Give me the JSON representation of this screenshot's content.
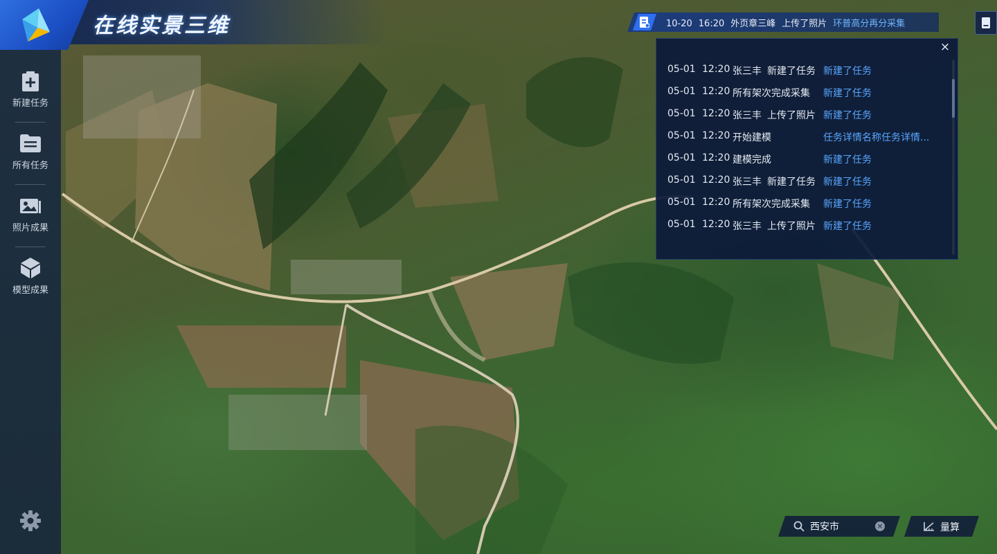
{
  "app": {
    "title": "在线实景三维"
  },
  "sidebar": {
    "items": [
      {
        "label": "新建任务",
        "icon": "new-task-icon"
      },
      {
        "label": "所有任务",
        "icon": "task-list-icon"
      },
      {
        "label": "照片成果",
        "icon": "photo-icon"
      },
      {
        "label": "模型成果",
        "icon": "cube-icon"
      }
    ],
    "settings_icon": "gear-icon"
  },
  "notice": {
    "date": "10-20",
    "time": "16:20",
    "user": "外页章三峰",
    "action": "上传了照片",
    "link": "环普高分再分采集"
  },
  "log_panel": {
    "close_label": "×",
    "rows": [
      {
        "date": "05-01",
        "time": "12:20",
        "user": "张三丰",
        "action": "新建了任务",
        "link": "新建了任务"
      },
      {
        "date": "05-01",
        "time": "12:20",
        "user": "所有架次完成采集",
        "action": "",
        "link": "新建了任务"
      },
      {
        "date": "05-01",
        "time": "12:20",
        "user": "张三丰",
        "action": "上传了照片",
        "link": "新建了任务"
      },
      {
        "date": "05-01",
        "time": "12:20",
        "user": "开始建模",
        "action": "",
        "link": "任务详情名称任务详情..."
      },
      {
        "date": "05-01",
        "time": "12:20",
        "user": "建模完成",
        "action": "",
        "link": "新建了任务"
      },
      {
        "date": "05-01",
        "time": "12:20",
        "user": "张三丰",
        "action": "新建了任务",
        "link": "新建了任务"
      },
      {
        "date": "05-01",
        "time": "12:20",
        "user": "所有架次完成采集",
        "action": "",
        "link": "新建了任务"
      },
      {
        "date": "05-01",
        "time": "12:20",
        "user": "张三丰",
        "action": "上传了照片",
        "link": "新建了任务"
      }
    ]
  },
  "search": {
    "value": "西安市",
    "clear_label": "×"
  },
  "measure": {
    "label": "量算"
  },
  "colors": {
    "accent": "#2f6ff0",
    "link": "#59a6ff",
    "panel": "#0c1a3a",
    "sidebar": "#1e2f40"
  }
}
